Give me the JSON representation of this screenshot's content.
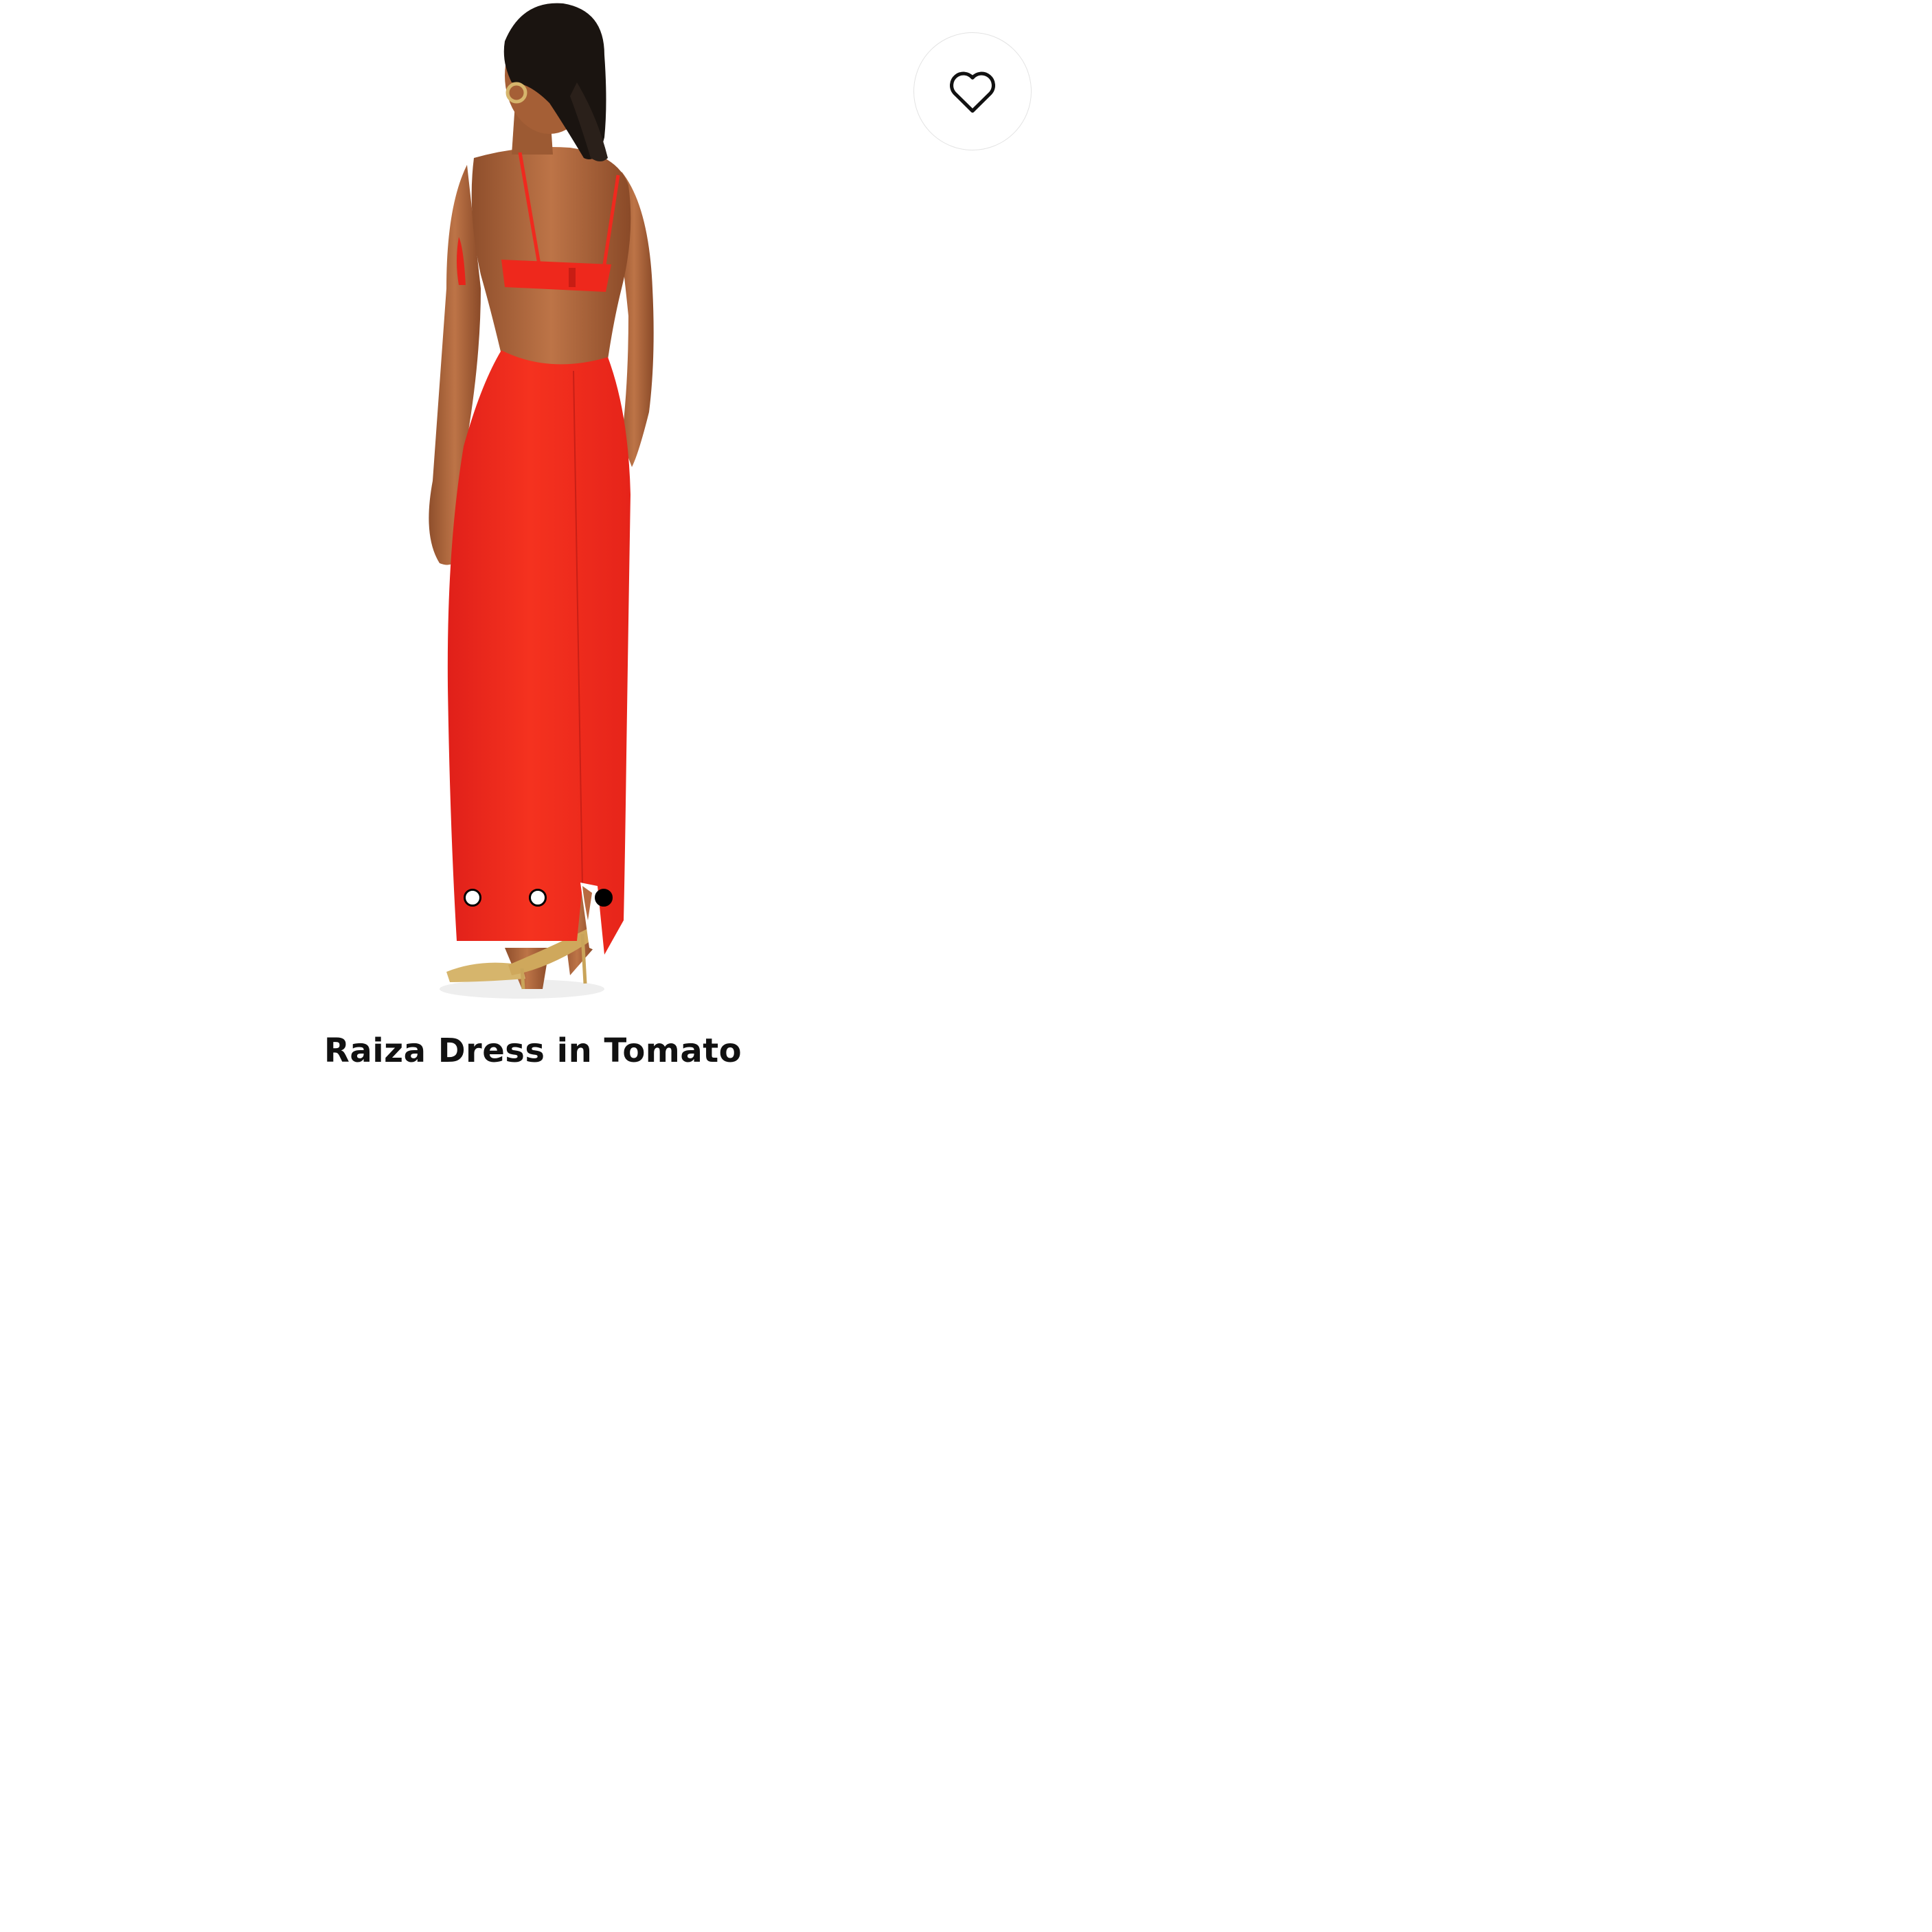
{
  "product": {
    "title": "Raiza Dress in Tomato",
    "image_description_icon": "product-photo",
    "dress_color": "#f0291e",
    "skin_color": "#b36a3e",
    "shoe_color": "#d6b56c"
  },
  "wishlist": {
    "icon": "heart-outline-icon"
  },
  "carousel": {
    "slides": [
      {
        "active": false
      },
      {
        "active": false
      },
      {
        "active": true
      }
    ],
    "active_color": "#000000",
    "inactive_color": "#ffffff"
  }
}
